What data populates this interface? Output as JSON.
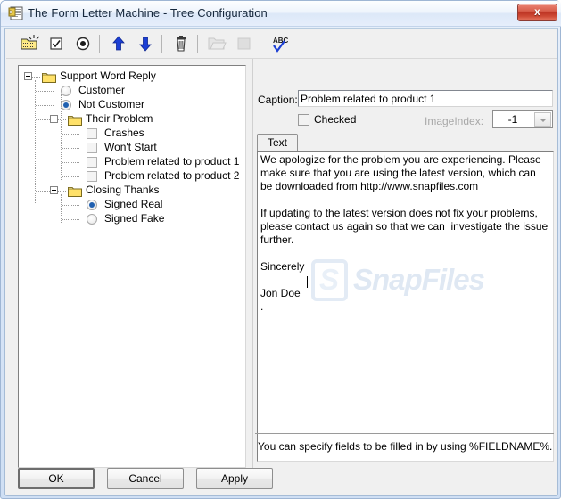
{
  "window": {
    "title": "The Form Letter Machine - Tree Configuration",
    "app_icon": "notepad-document-icon",
    "close_label": "x"
  },
  "toolbar": {
    "buttons": [
      {
        "name": "new-folder-node",
        "icon": "new-folder-icon",
        "enabled": true
      },
      {
        "name": "new-check-node",
        "icon": "checkbox-icon",
        "enabled": true
      },
      {
        "name": "new-radio-node",
        "icon": "radio-icon",
        "enabled": true
      },
      {
        "name": "move-up",
        "icon": "arrow-up-icon",
        "enabled": true
      },
      {
        "name": "move-down",
        "icon": "arrow-down-icon",
        "enabled": true
      },
      {
        "name": "delete-node",
        "icon": "trash-icon",
        "enabled": true
      },
      {
        "name": "open-file",
        "icon": "open-folder-icon",
        "enabled": false
      },
      {
        "name": "stop",
        "icon": "stop-square-icon",
        "enabled": false
      },
      {
        "name": "spell-check",
        "icon": "abc-check-icon",
        "enabled": true
      }
    ]
  },
  "tree": {
    "nodes": [
      {
        "label": "Support Word Reply",
        "type": "folder",
        "level": 0,
        "expanded": true,
        "selected": false
      },
      {
        "label": "Customer",
        "type": "radio",
        "level": 1,
        "checked": false
      },
      {
        "label": "Not Customer",
        "type": "radio",
        "level": 1,
        "checked": true
      },
      {
        "label": "Their Problem",
        "type": "folder",
        "level": 1,
        "expanded": true
      },
      {
        "label": "Crashes",
        "type": "checkbox",
        "level": 2,
        "checked": false
      },
      {
        "label": "Won't Start",
        "type": "checkbox",
        "level": 2,
        "checked": false
      },
      {
        "label": "Problem related to product 1",
        "type": "checkbox",
        "level": 2,
        "checked": false
      },
      {
        "label": "Problem related to product 2",
        "type": "checkbox",
        "level": 2,
        "checked": false
      },
      {
        "label": "Closing Thanks",
        "type": "folder",
        "level": 1,
        "expanded": true
      },
      {
        "label": "Signed Real",
        "type": "radio",
        "level": 2,
        "checked": true
      },
      {
        "label": "Signed Fake",
        "type": "radio",
        "level": 2,
        "checked": false
      }
    ]
  },
  "details": {
    "caption_label": "Caption:",
    "caption_value": "Problem related to product 1",
    "caption_placeholder": "",
    "checked_label": "Checked",
    "checked_value": false,
    "imageindex_label": "ImageIndex:",
    "imageindex_value": "-1",
    "imageindex_enabled": false,
    "tabs": [
      {
        "label": "Text",
        "active": true
      }
    ],
    "text_value": "We apologize for the problem you are experiencing. Please make sure that you are using the latest version, which can be downloaded from http://www.snapfiles.com\n\nIf updating to the latest version does not fix your problems, please contact us again so that we can  investigate the issue further.\n\nSincerely\n\nJon Doe\n.",
    "hint": "You can specify fields to be filled in by using %FIELDNAME%."
  },
  "watermark": {
    "badge": "S",
    "text": "SnapFiles"
  },
  "footer": {
    "ok_label": "OK",
    "cancel_label": "Cancel",
    "apply_label": "Apply"
  },
  "colors": {
    "titlebar": "#e8f0fb",
    "close_button": "#bb3222",
    "accent_selection": "#2060b0",
    "folder": "#ffe169",
    "arrow_blue": "#1c3fd4",
    "disabled_text": "#a8a8a8"
  }
}
